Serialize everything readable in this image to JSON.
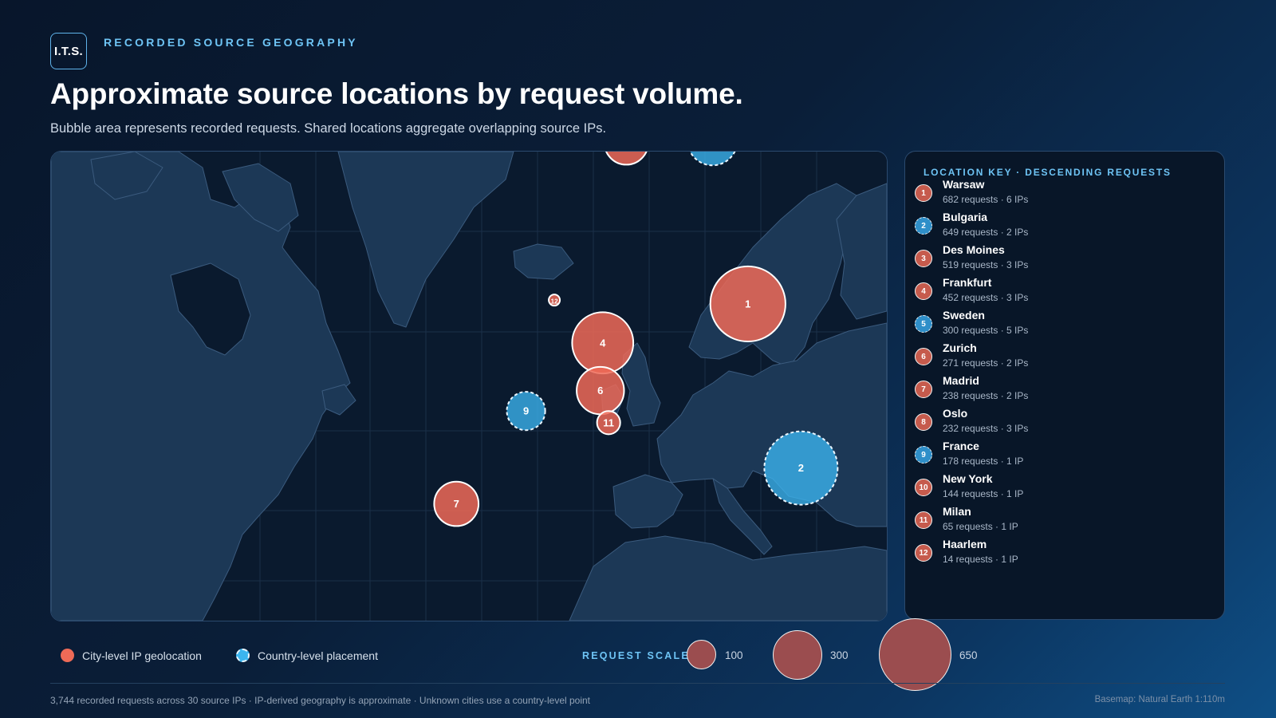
{
  "header": {
    "logo": "I.T.S.",
    "eyebrow": "RECORDED SOURCE GEOGRAPHY",
    "title": "Approximate source locations by request volume.",
    "subtitle": "Bubble area represents recorded requests. Shared locations aggregate overlapping source IPs."
  },
  "colors": {
    "city": "#ee6a57",
    "country": "#3bb5ef",
    "land": "#1c3856",
    "ocean": "#0a1a2e",
    "accent": "#6ec4f5"
  },
  "locations": [
    {
      "rank": "1",
      "name": "Warsaw",
      "requests": 682,
      "stats": "682 requests · 6 IPs",
      "level": "city",
      "lon": 21.0,
      "lat": 52.2
    },
    {
      "rank": "2",
      "name": "Bulgaria",
      "requests": 649,
      "stats": "649 requests · 2 IPs",
      "level": "country",
      "lon": 25.5,
      "lat": 42.7
    },
    {
      "rank": "3",
      "name": "Des Moines",
      "requests": 519,
      "stats": "519 requests · 3 IPs",
      "level": "city",
      "lon": -93.6,
      "lat": 41.6
    },
    {
      "rank": "4",
      "name": "Frankfurt",
      "requests": 452,
      "stats": "452 requests · 3 IPs",
      "level": "city",
      "lon": 8.7,
      "lat": 50.1
    },
    {
      "rank": "5",
      "name": "Sweden",
      "requests": 300,
      "stats": "300 requests · 5 IPs",
      "level": "country",
      "lon": 18.0,
      "lat": 60.0
    },
    {
      "rank": "6",
      "name": "Zurich",
      "requests": 271,
      "stats": "271 requests · 2 IPs",
      "level": "city",
      "lon": 8.5,
      "lat": 47.4
    },
    {
      "rank": "7",
      "name": "Madrid",
      "requests": 238,
      "stats": "238 requests · 2 IPs",
      "level": "city",
      "lon": -3.7,
      "lat": 40.4
    },
    {
      "rank": "8",
      "name": "Oslo",
      "requests": 232,
      "stats": "232 requests · 3 IPs",
      "level": "city",
      "lon": 10.7,
      "lat": 59.9
    },
    {
      "rank": "9",
      "name": "France",
      "requests": 178,
      "stats": "178 requests · 1 IP",
      "level": "country",
      "lon": 2.2,
      "lat": 46.2
    },
    {
      "rank": "10",
      "name": "New York",
      "requests": 144,
      "stats": "144 requests · 1 IP",
      "level": "city",
      "lon": -74.0,
      "lat": 40.7
    },
    {
      "rank": "11",
      "name": "Milan",
      "requests": 65,
      "stats": "65 requests · 1 IP",
      "level": "city",
      "lon": 9.2,
      "lat": 45.5
    },
    {
      "rank": "12",
      "name": "Haarlem",
      "requests": 14,
      "stats": "14 requests · 1 IP",
      "level": "city",
      "lon": 4.6,
      "lat": 52.4
    }
  ],
  "panel": {
    "title": "LOCATION KEY · DESCENDING REQUESTS"
  },
  "legend": {
    "city_label": "City-level IP geolocation",
    "country_label": "Country-level placement",
    "scale_label": "REQUEST SCALE",
    "scale_values": [
      "100",
      "300",
      "650"
    ]
  },
  "footer": {
    "left": "3,744 recorded requests across 30 source IPs · IP-derived geography is approximate · Unknown cities use a country-level point",
    "right": "Basemap: Natural Earth 1:110m"
  }
}
